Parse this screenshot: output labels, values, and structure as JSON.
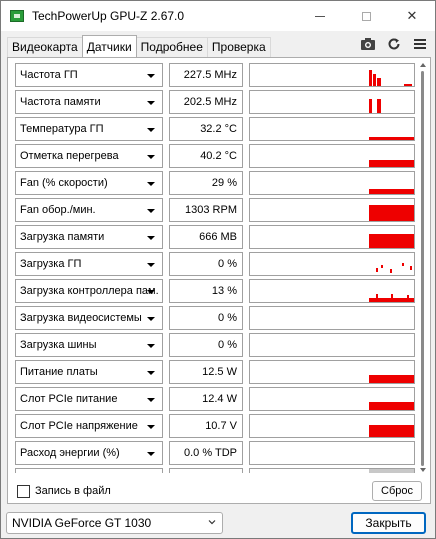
{
  "window": {
    "title": "TechPowerUp GPU-Z 2.67.0",
    "close_glyph": "✕"
  },
  "tabs": [
    {
      "label": "Видеокарта",
      "active": false
    },
    {
      "label": "Датчики",
      "active": true
    },
    {
      "label": "Подробнее",
      "active": false
    },
    {
      "label": "Проверка",
      "active": false
    }
  ],
  "toolbar_icons": [
    "camera-icon",
    "refresh-icon",
    "menu-icon"
  ],
  "colors": {
    "graph": "#ee0000",
    "accent": "#0067c0"
  },
  "sensors": [
    {
      "label": "Частота ГП",
      "value": "227.5 MHz"
    },
    {
      "label": "Частота памяти",
      "value": "202.5 MHz"
    },
    {
      "label": "Температура ГП",
      "value": "32.2 °C"
    },
    {
      "label": "Отметка перегрева",
      "value": "40.2 °C"
    },
    {
      "label": "Fan (% скорости)",
      "value": "29 %"
    },
    {
      "label": "Fan обор./мин.",
      "value": "1303 RPM"
    },
    {
      "label": "Загрузка памяти",
      "value": "666 MB"
    },
    {
      "label": "Загрузка ГП",
      "value": "0 %"
    },
    {
      "label": "Загрузка контроллера пам.",
      "value": "13 %"
    },
    {
      "label": "Загрузка видеосистемы",
      "value": "0 %"
    },
    {
      "label": "Загрузка шины",
      "value": "0 %"
    },
    {
      "label": "Питание платы",
      "value": "12.5 W"
    },
    {
      "label": "Слот PCIe питание",
      "value": "12.4 W"
    },
    {
      "label": "Слот PCIe напряжение",
      "value": "10.7 V"
    },
    {
      "label": "Расход энергии (%)",
      "value": "0.0 % TDP"
    },
    {
      "label": "",
      "value": ""
    }
  ],
  "footer": {
    "log_label": "Запись в файл",
    "log_checked": false,
    "reset_label": "Сброс"
  },
  "bottom": {
    "gpu_selected": "NVIDIA GeForce GT 1030",
    "close_label": "Закрыть"
  }
}
